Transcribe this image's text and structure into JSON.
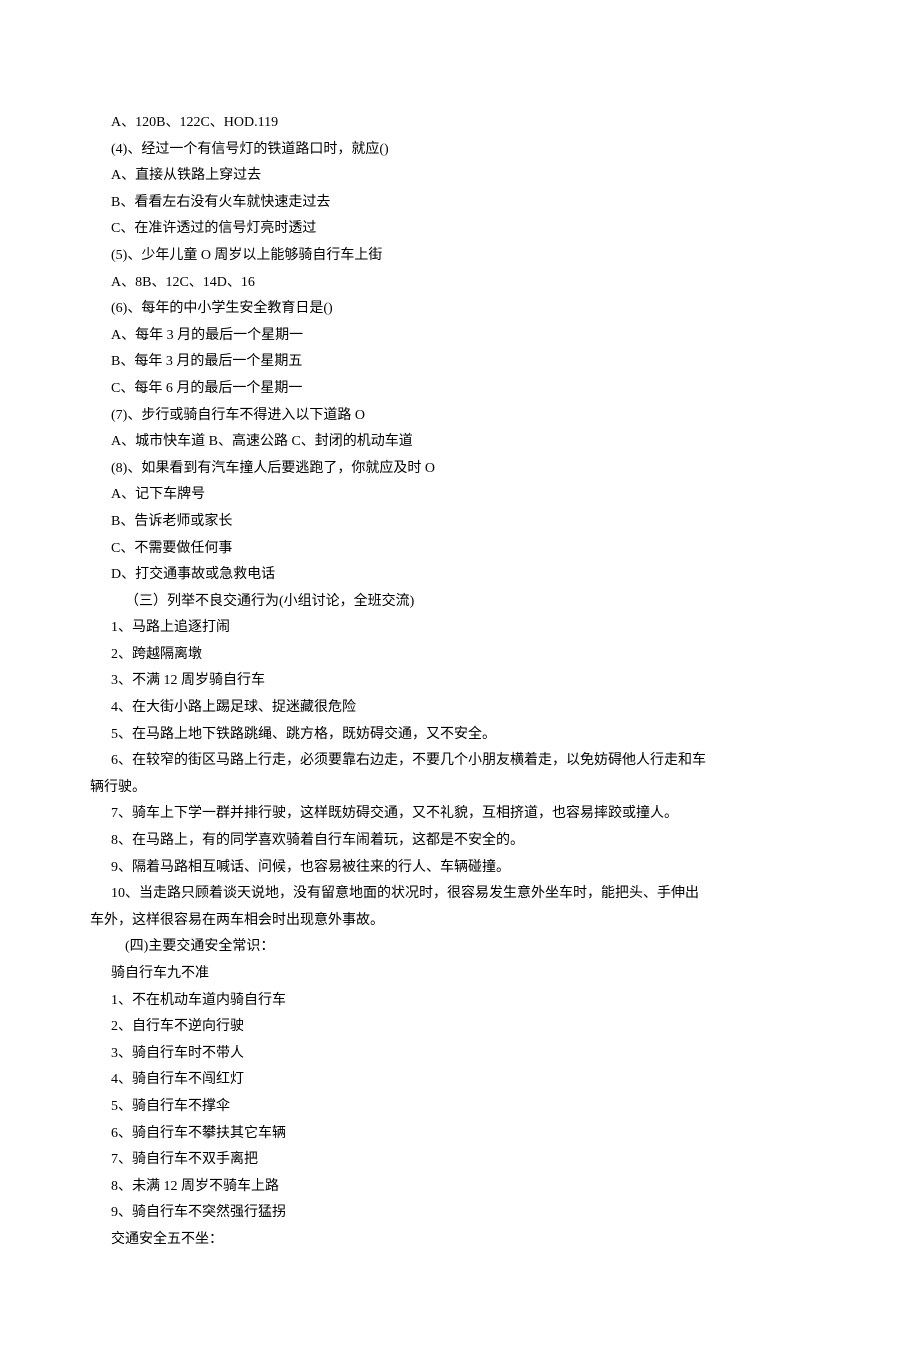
{
  "lines": [
    {
      "cls": "line",
      "text": "A、120B、122C、HOD.119"
    },
    {
      "cls": "line",
      "text": "(4)、经过一个有信号灯的铁道路口时，就应()"
    },
    {
      "cls": "line",
      "text": "A、直接从铁路上穿过去"
    },
    {
      "cls": "line",
      "text": "B、看看左右没有火车就快速走过去"
    },
    {
      "cls": "line",
      "text": "C、在准许透过的信号灯亮时透过"
    },
    {
      "cls": "line",
      "text": "(5)、少年儿童 O 周岁以上能够骑自行车上街"
    },
    {
      "cls": "line",
      "text": "A、8B、12C、14D、16"
    },
    {
      "cls": "line",
      "text": "(6)、每年的中小学生安全教育日是()"
    },
    {
      "cls": "line",
      "text": "A、每年 3 月的最后一个星期一"
    },
    {
      "cls": "line",
      "text": "B、每年 3 月的最后一个星期五"
    },
    {
      "cls": "line",
      "text": "C、每年 6 月的最后一个星期一"
    },
    {
      "cls": "line",
      "text": "(7)、步行或骑自行车不得进入以下道路 O"
    },
    {
      "cls": "line",
      "text": "A、城市快车道 B、高速公路 C、封闭的机动车道"
    },
    {
      "cls": "line",
      "text": "(8)、如果看到有汽车撞人后要逃跑了，你就应及时 O"
    },
    {
      "cls": "line",
      "text": "A、记下车牌号"
    },
    {
      "cls": "line",
      "text": "B、告诉老师或家长"
    },
    {
      "cls": "line",
      "text": "C、不需要做任何事"
    },
    {
      "cls": "line",
      "text": "D、打交通事故或急救电话"
    },
    {
      "cls": "line-extra",
      "text": "（三）列举不良交通行为(小组讨论，全班交流)"
    },
    {
      "cls": "line",
      "text": "1、马路上追逐打闹"
    },
    {
      "cls": "line",
      "text": "2、跨越隔离墩"
    },
    {
      "cls": "line",
      "text": "3、不满 12 周岁骑自行车"
    },
    {
      "cls": "line",
      "text": "4、在大街小路上踢足球、捉迷藏很危险"
    },
    {
      "cls": "line",
      "text": "5、在马路上地下铁路跳绳、跳方格，既妨碍交通，又不安全。"
    },
    {
      "cls": "line",
      "text": "6、在较窄的街区马路上行走，必须要靠右边走，不要几个小朋友横着走，以免妨碍他人行走和车"
    },
    {
      "cls": "line-noindent",
      "text": "辆行驶。"
    },
    {
      "cls": "line",
      "text": "7、骑车上下学一群并排行驶，这样既妨碍交通，又不礼貌，互相挤道，也容易摔跤或撞人。"
    },
    {
      "cls": "line",
      "text": "8、在马路上，有的同学喜欢骑着自行车闹着玩，这都是不安全的。"
    },
    {
      "cls": "line",
      "text": "9、隔着马路相互喊话、问候，也容易被往来的行人、车辆碰撞。"
    },
    {
      "cls": "line",
      "text": "10、当走路只顾着谈天说地，没有留意地面的状况时，很容易发生意外坐车时，能把头、手伸出"
    },
    {
      "cls": "line-noindent",
      "text": "车外，这样很容易在两车相会时出现意外事故。"
    },
    {
      "cls": "line-extra",
      "text": "(四)主要交通安全常识："
    },
    {
      "cls": "line",
      "text": "骑自行车九不准"
    },
    {
      "cls": "line",
      "text": "1、不在机动车道内骑自行车"
    },
    {
      "cls": "line",
      "text": "2、自行车不逆向行驶"
    },
    {
      "cls": "line",
      "text": "3、骑自行车时不带人"
    },
    {
      "cls": "line",
      "text": "4、骑自行车不闯红灯"
    },
    {
      "cls": "line",
      "text": "5、骑自行车不撑伞"
    },
    {
      "cls": "line",
      "text": "6、骑自行车不攀扶其它车辆"
    },
    {
      "cls": "line",
      "text": "7、骑自行车不双手离把"
    },
    {
      "cls": "line",
      "text": "8、未满 12 周岁不骑车上路"
    },
    {
      "cls": "line",
      "text": "9、骑自行车不突然强行猛拐"
    },
    {
      "cls": "line",
      "text": "交通安全五不坐："
    }
  ]
}
